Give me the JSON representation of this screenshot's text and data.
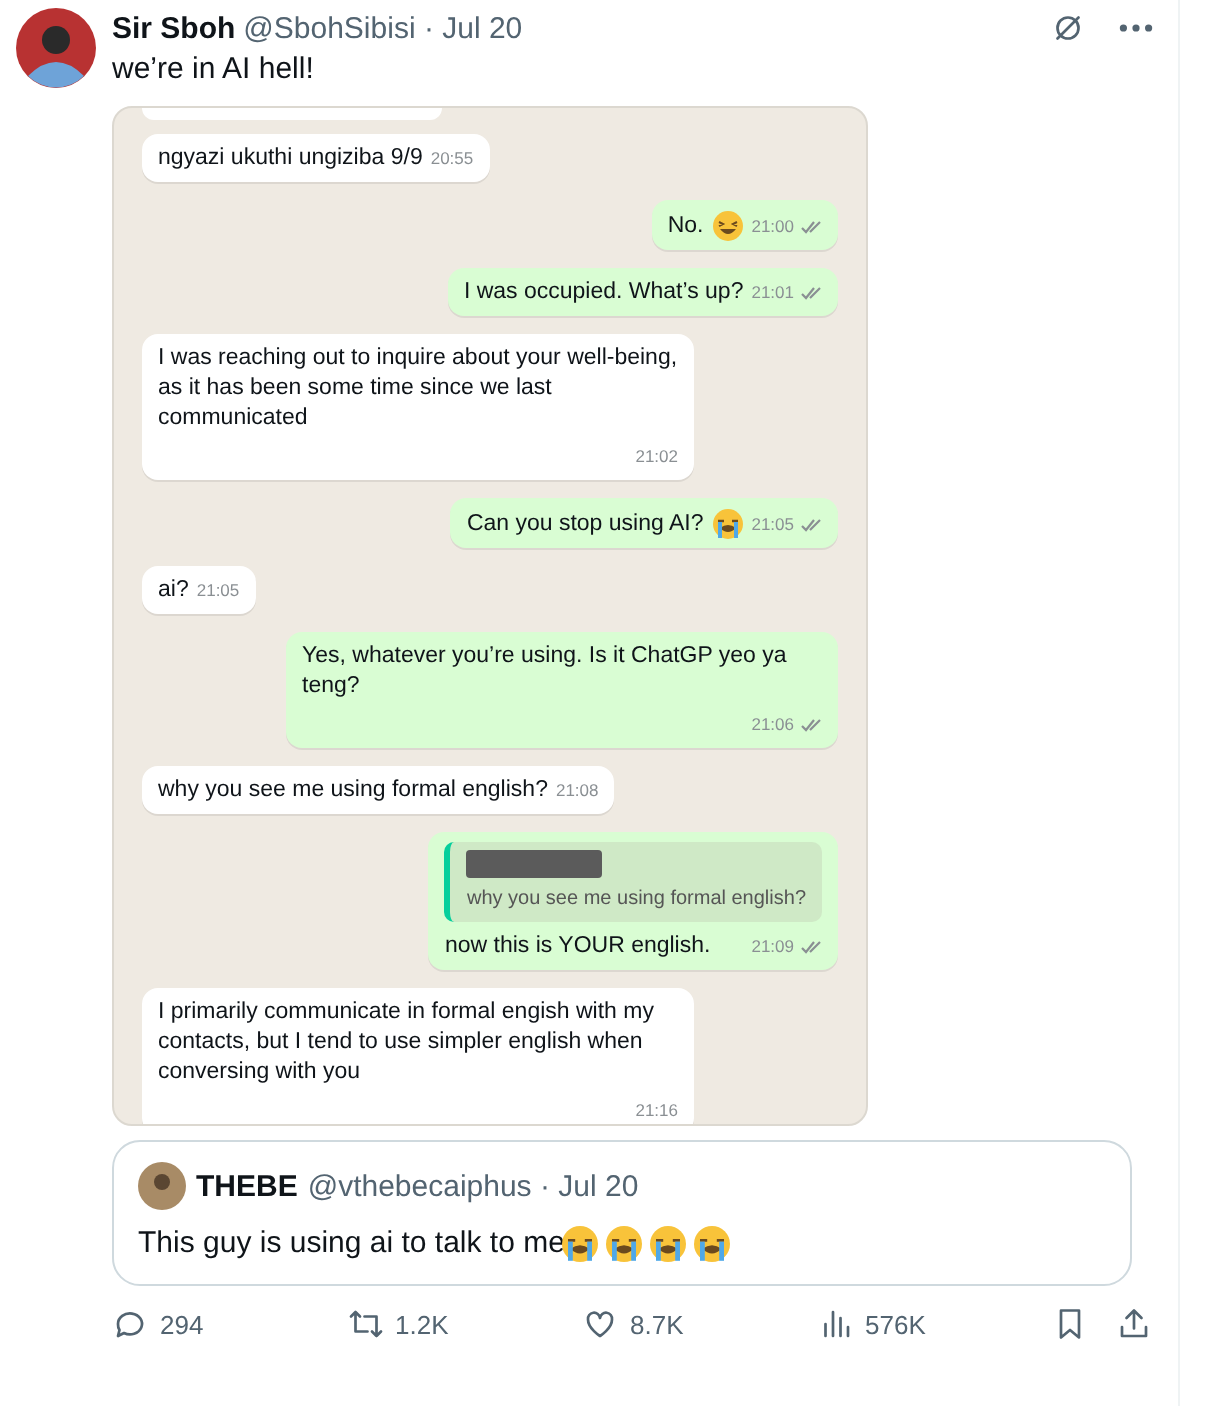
{
  "post": {
    "author": "Sir Sboh",
    "handle": "@SbohSibisi · Jul 20",
    "text": "we’re in AI hell!"
  },
  "chat": {
    "messages": [
      {
        "kind": "incoming",
        "text": "ngyazi ukuthi ungiziba 9/9",
        "time": "20:55"
      },
      {
        "kind": "outgoing",
        "text": "No.",
        "emoji": {
          "kind": "laughing"
        },
        "time": "21:00",
        "ticks": true
      },
      {
        "kind": "outgoing",
        "text": "I was occupied. What’s up?",
        "time": "21:01",
        "ticks": true
      },
      {
        "kind": "incoming",
        "text": "I was reaching out to inquire about your well-being, as it has been some time since we last communicated",
        "time": "21:02"
      },
      {
        "kind": "outgoing",
        "text": "Can you stop using AI?",
        "emoji": {
          "kind": "crying"
        },
        "time": "21:05",
        "ticks": true
      },
      {
        "kind": "incoming",
        "text": "ai?",
        "time": "21:05"
      },
      {
        "kind": "outgoing",
        "text": "Yes, whatever you’re using. Is it ChatGP yeo ya teng?",
        "time": "21:06",
        "ticks": true
      },
      {
        "kind": "incoming",
        "text": "why you see me using formal english?",
        "time": "21:08"
      },
      {
        "kind": "outgoing",
        "quote": "why you see me using formal english?",
        "text": "now this is YOUR english.",
        "time": "21:09",
        "ticks": true
      },
      {
        "kind": "incoming",
        "text": "I primarily communicate in formal engish with my contacts, but I tend to use simpler english when conversing with you",
        "time": "21:16"
      }
    ]
  },
  "quoted": {
    "author": "THEBE",
    "handle": "@vthebecaiphus · Jul 20",
    "text": "This guy is using ai to talk to me",
    "emojis": [
      {
        "kind": "crying"
      },
      {
        "kind": "crying"
      },
      {
        "kind": "crying"
      },
      {
        "kind": "crying"
      }
    ]
  },
  "actions": [
    {
      "kind": "reply",
      "count": "294"
    },
    {
      "kind": "repost",
      "count": "1.2K"
    },
    {
      "kind": "like",
      "count": "8.7K"
    },
    {
      "kind": "views",
      "count": "576K"
    }
  ]
}
